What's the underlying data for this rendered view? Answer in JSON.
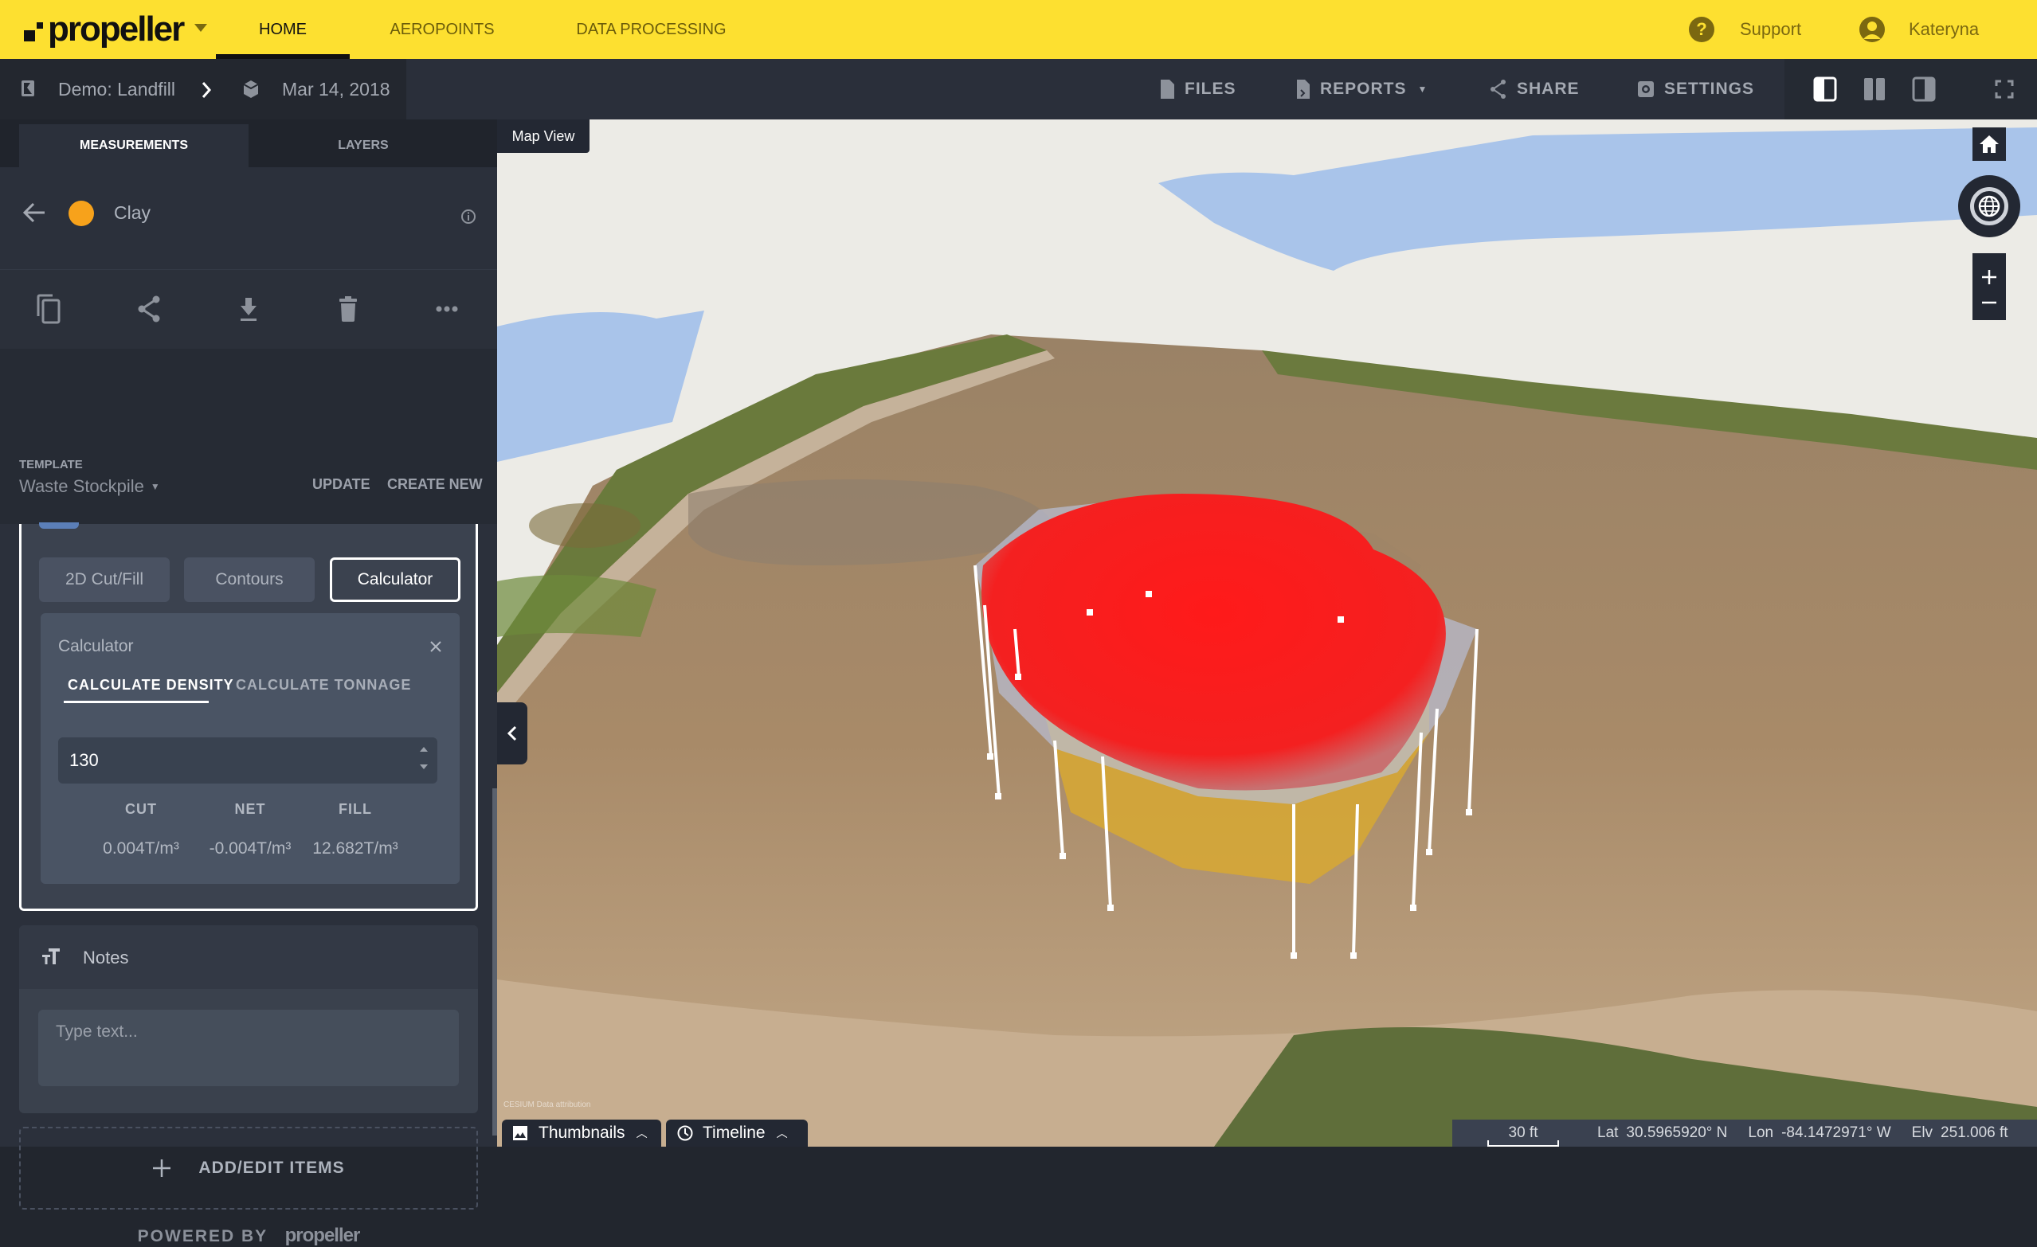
{
  "topnav": {
    "brand": "propeller",
    "tabs": [
      {
        "label": "HOME",
        "active": true
      },
      {
        "label": "AEROPOINTS",
        "active": false
      },
      {
        "label": "DATA PROCESSING",
        "active": false
      }
    ],
    "support_label": "Support",
    "user_name": "Kateryna"
  },
  "subbar": {
    "site": "Demo: Landfill",
    "survey_date": "Mar 14, 2018",
    "tools": {
      "files": "FILES",
      "reports": "REPORTS",
      "share": "SHARE",
      "settings": "SETTINGS"
    }
  },
  "panel": {
    "tabs": {
      "measurements": "MEASUREMENTS",
      "layers": "LAYERS"
    },
    "measurement": {
      "name": "Clay",
      "color": "#f7a21b"
    },
    "template": {
      "label": "TEMPLATE",
      "selected": "Waste Stockpile",
      "update": "UPDATE",
      "create_new": "CREATE NEW"
    },
    "analysis_tabs": [
      {
        "label": "2D Cut/Fill",
        "active": false
      },
      {
        "label": "Contours",
        "active": false
      },
      {
        "label": "Calculator",
        "active": true
      }
    ],
    "calculator": {
      "title": "Calculator",
      "tabs": [
        {
          "label": "CALCULATE DENSITY",
          "active": true
        },
        {
          "label": "CALCULATE TONNAGE",
          "active": false
        }
      ],
      "input_value": "130",
      "columns": [
        {
          "header": "CUT",
          "value": "0.004T/m³"
        },
        {
          "header": "NET",
          "value": "-0.004T/m³"
        },
        {
          "header": "FILL",
          "value": "12.682T/m³"
        }
      ]
    },
    "notes": {
      "title": "Notes",
      "placeholder": "Type text..."
    },
    "add_edit": "ADD/EDIT ITEMS",
    "powered_by": "POWERED BY",
    "powered_brand": "propeller"
  },
  "map": {
    "view_label": "Map View",
    "attribution": "CESIUM  Data attribution",
    "thumbnails": "Thumbnails",
    "timeline": "Timeline",
    "scale": "30 ft",
    "lat_label": "Lat",
    "lat": "30.5965920° N",
    "lon_label": "Lon",
    "lon": "-84.1472971° W",
    "elv_label": "Elv",
    "elv": "251.006 ft"
  }
}
